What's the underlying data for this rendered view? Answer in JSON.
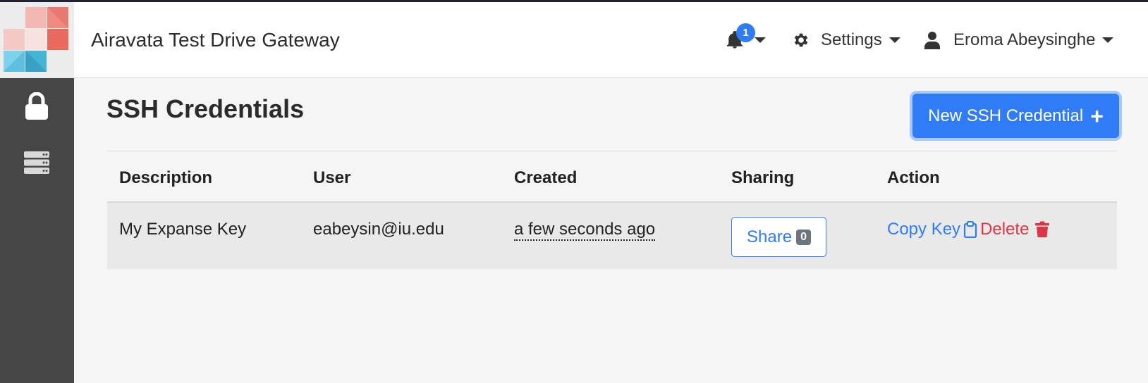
{
  "header": {
    "app_title": "Airavata Test Drive Gateway",
    "notifications": {
      "icon": "bell-icon",
      "count": "1"
    },
    "settings_label": "Settings",
    "user_name": "Eroma Abeysinghe"
  },
  "sidebar": {
    "items": [
      {
        "icon": "lock-icon"
      },
      {
        "icon": "server-icon"
      }
    ]
  },
  "page": {
    "title": "SSH Credentials",
    "new_button_label": "New SSH Credential"
  },
  "table": {
    "headers": {
      "description": "Description",
      "user": "User",
      "created": "Created",
      "sharing": "Sharing",
      "action": "Action"
    },
    "rows": [
      {
        "description": "My Expanse Key",
        "user": "eabeysin@iu.edu",
        "created": "a few seconds ago",
        "share_label": "Share",
        "share_count": "0",
        "copy_label": "Copy Key",
        "delete_label": "Delete"
      }
    ]
  },
  "colors": {
    "primary": "#2f7cf6",
    "danger": "#dc3545",
    "sidebar": "#464646"
  }
}
